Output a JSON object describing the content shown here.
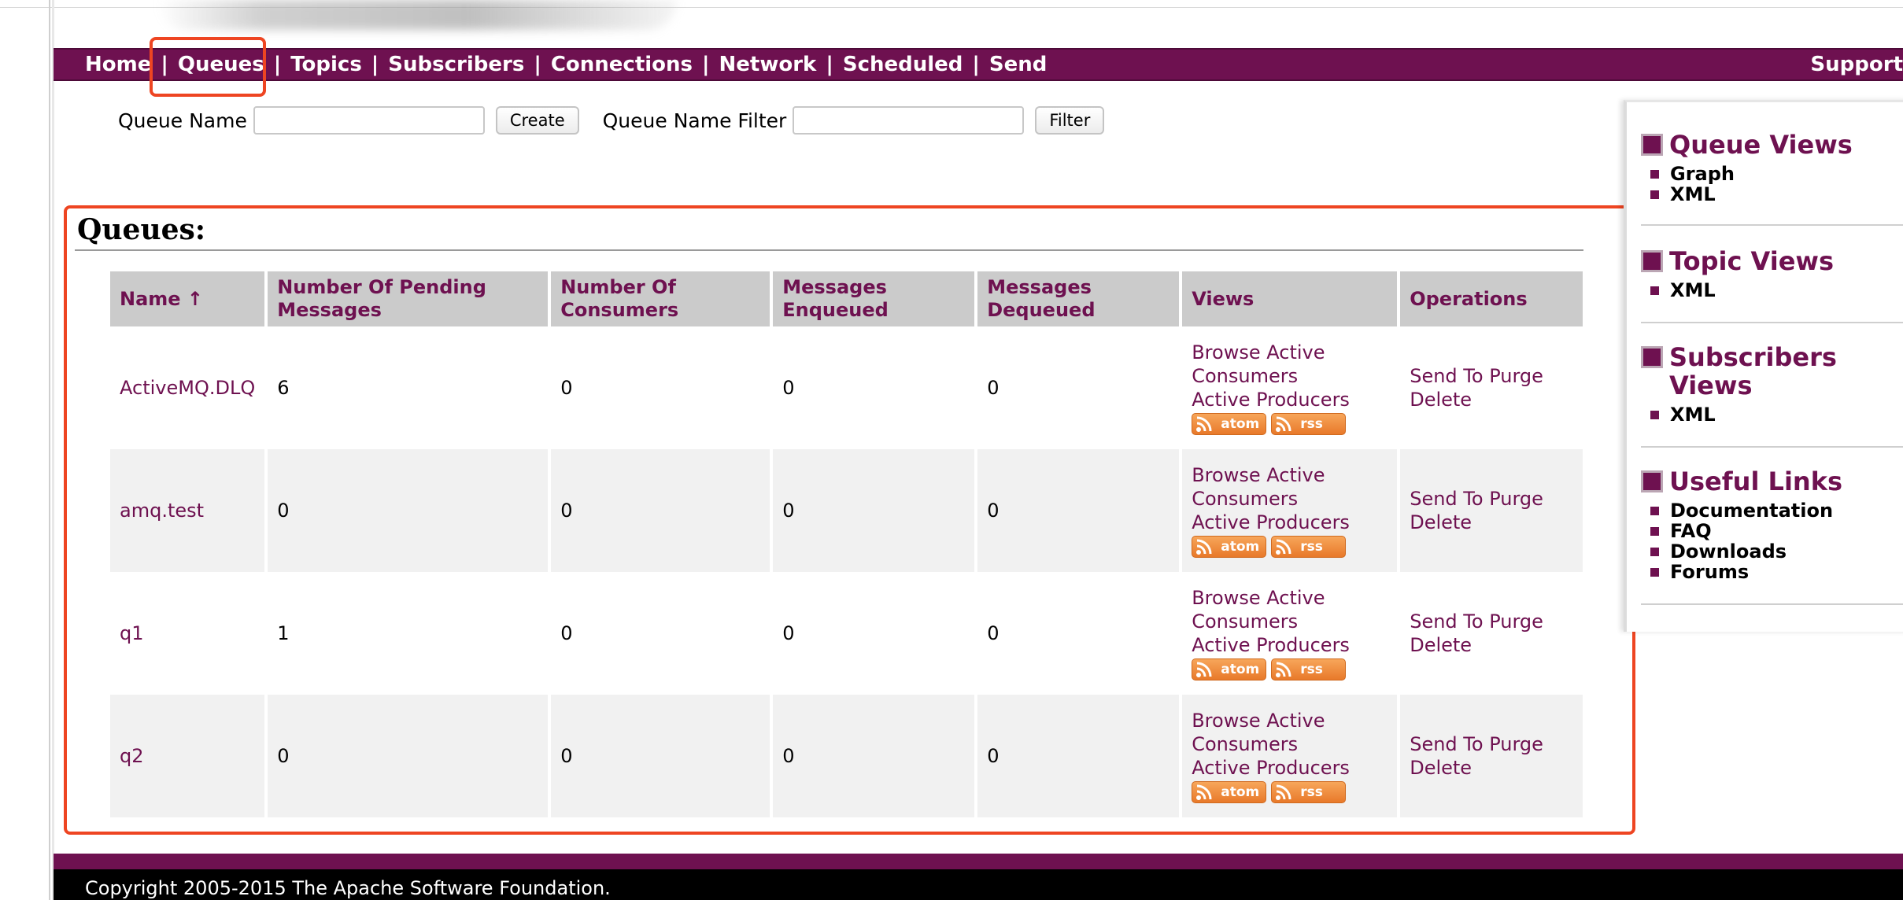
{
  "nav": {
    "items": [
      "Home",
      "Queues",
      "Topics",
      "Subscribers",
      "Connections",
      "Network",
      "Scheduled",
      "Send"
    ],
    "separator": "|",
    "support": "Support"
  },
  "form": {
    "queue_name_label": "Queue Name",
    "queue_name_value": "",
    "create_label": "Create",
    "filter_label_text": "Queue Name Filter",
    "filter_value": "",
    "filter_button": "Filter"
  },
  "queues": {
    "title": "Queues:",
    "columns": [
      "Name ↑",
      "Number Of Pending Messages",
      "Number Of Consumers",
      "Messages Enqueued",
      "Messages Dequeued",
      "Views",
      "Operations"
    ],
    "rows": [
      {
        "name": "ActiveMQ.DLQ",
        "pending": "6",
        "consumers": "0",
        "enqueued": "0",
        "dequeued": "0"
      },
      {
        "name": "amq.test",
        "pending": "0",
        "consumers": "0",
        "enqueued": "0",
        "dequeued": "0"
      },
      {
        "name": "q1",
        "pending": "1",
        "consumers": "0",
        "enqueued": "0",
        "dequeued": "0"
      },
      {
        "name": "q2",
        "pending": "0",
        "consumers": "0",
        "enqueued": "0",
        "dequeued": "0"
      }
    ],
    "views_links": {
      "browse": "Browse",
      "active_consumers": "Active Consumers",
      "active_producers": "Active Producers",
      "atom": "atom",
      "rss": "rss"
    },
    "ops_links": {
      "send_to": "Send To",
      "purge": "Purge",
      "delete": "Delete"
    }
  },
  "sidebar": {
    "sections": [
      {
        "title": "Queue Views",
        "items": [
          "Graph",
          "XML"
        ]
      },
      {
        "title": "Topic Views",
        "items": [
          "XML"
        ]
      },
      {
        "title": "Subscribers Views",
        "items": [
          "XML"
        ]
      },
      {
        "title": "Useful Links",
        "items": [
          "Documentation",
          "FAQ",
          "Downloads",
          "Forums"
        ]
      }
    ]
  },
  "footer": {
    "copyright": "Copyright 2005-2015 The Apache Software Foundation."
  },
  "colors": {
    "brand": "#6e1150",
    "highlight": "#ee4522",
    "feed": "#f08a3a"
  },
  "icons": [
    "feed-icon"
  ]
}
